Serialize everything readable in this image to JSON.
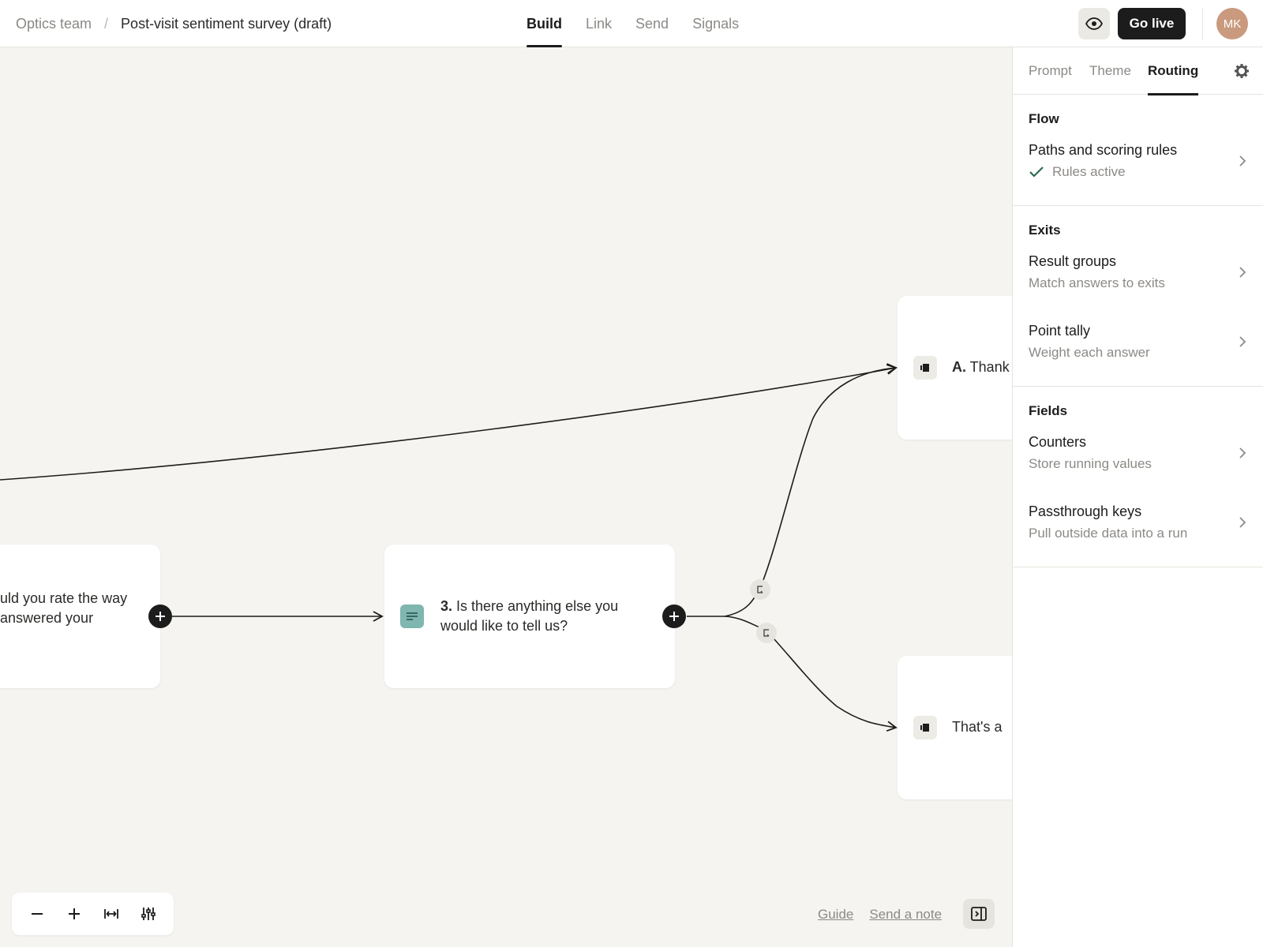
{
  "header": {
    "team": "Optics team",
    "separator": "/",
    "title": "Post-visit sentiment survey (draft)",
    "tabs": [
      {
        "label": "Build",
        "active": true
      },
      {
        "label": "Link",
        "active": false
      },
      {
        "label": "Send",
        "active": false
      },
      {
        "label": "Signals",
        "active": false
      }
    ],
    "go_live": "Go live",
    "avatar_initials": "MK"
  },
  "canvas": {
    "nodes": {
      "q2_partial_line1": "uld you rate the way",
      "q2_partial_line2": " answered your",
      "q3_number": "3.",
      "q3_text": " Is there anything else you would like to tell us?",
      "end_a_number": "A.",
      "end_a_text": " Thank",
      "end_b_text": "That's a"
    },
    "footer": {
      "guide": "Guide",
      "send_note": "Send a note"
    }
  },
  "panel": {
    "tabs": [
      {
        "label": "Prompt",
        "active": false
      },
      {
        "label": "Theme",
        "active": false
      },
      {
        "label": "Routing",
        "active": true
      }
    ],
    "sections": [
      {
        "title": "Flow",
        "items": [
          {
            "title": "Paths and scoring rules",
            "subtitle": "Rules active",
            "status": "check"
          }
        ]
      },
      {
        "title": "Exits",
        "items": [
          {
            "title": "Result groups",
            "subtitle": "Match answers to exits"
          },
          {
            "title": "Point tally",
            "subtitle": "Weight each answer"
          }
        ]
      },
      {
        "title": "Fields",
        "items": [
          {
            "title": "Counters",
            "subtitle": "Store running values"
          },
          {
            "title": "Passthrough keys",
            "subtitle": "Pull outside data into a run"
          }
        ]
      }
    ]
  },
  "colors": {
    "accent_teal": "#7fb6b0",
    "dark": "#1c1c1c",
    "canvas_bg": "#f5f4f0",
    "avatar": "#c99a7e"
  }
}
